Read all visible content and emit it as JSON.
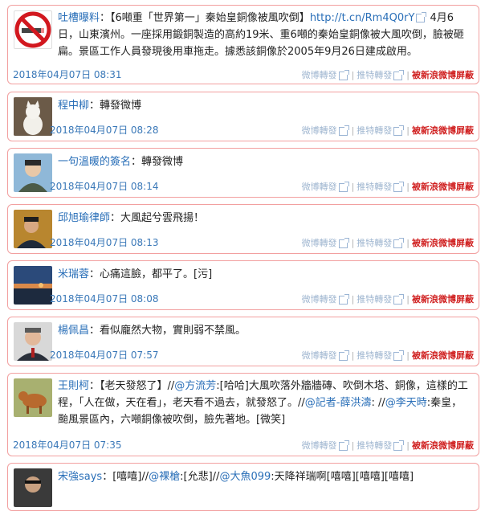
{
  "posts": [
    {
      "user": "吐槽曝料",
      "colon": "：",
      "text_a": "【6噸重「世界第一」秦始皇銅像被風吹倒】",
      "link": "http://t.cn/Rm4Q0rY",
      "text_b": " 4月6日，山東濱州。一座採用鍛銅製造的高約19米、重6噸的秦始皇銅像被大風吹倒，臉被砸扁。景區工作人員發現後用車拖走。據悉該銅像於2005年9月26日建成啟用。",
      "time": "2018年04月07日 08:31",
      "avatar_icon": "no-smoking-icon"
    },
    {
      "user": "程中柳",
      "text": "：轉發微博",
      "time": "2018年04月07日 08:28",
      "avatar_icon": "cat-photo-icon"
    },
    {
      "user": "一句溫暖的簽名",
      "text": "：轉發微博",
      "time": "2018年04月07日 08:14",
      "avatar_icon": "portrait-photo-icon"
    },
    {
      "user": "邱旭瑜律師",
      "text": "：大風起兮雲飛揚！",
      "time": "2018年04月07日 08:13",
      "avatar_icon": "portrait-photo-icon"
    },
    {
      "user": "米瑞蓉",
      "text": "：心痛這臉，都平了。[污]",
      "time": "2018年04月07日 08:08",
      "avatar_icon": "sunset-photo-icon"
    },
    {
      "user": "楊佩昌",
      "text": "：看似龐然大物，實則弱不禁風。",
      "time": "2018年04月07日 07:57",
      "avatar_icon": "portrait-photo-icon"
    },
    {
      "user": "王則柯",
      "text_a": "：【老天發怒了】//",
      "m1": "@方流芳",
      "text_b": ":[哈哈]大風吹落外牆牆磚、吹倒木塔、銅像，這樣的工程，「人在做，天在看」，老天看不過去，就發怒了。//",
      "m2": "@記者-薛洪濤",
      "text_c": ": //",
      "m3": "@李天時",
      "text_d": ":秦皇，颱風景區內，六噸銅像被吹倒，臉先著地。[微笑]",
      "time": "2018年04月07日 07:35",
      "avatar_icon": "dog-photo-icon"
    },
    {
      "user": "宋強says",
      "text_a": "：[嘻嘻]//",
      "m1": "@裸槍",
      "text_b": ":[允悲]//",
      "m2": "@大魚099",
      "text_c": ":天降祥瑞啊[嘻嘻][嘻嘻][嘻嘻]",
      "avatar_icon": "portrait-photo-icon"
    }
  ],
  "actions": {
    "weibo_repost": "微博轉發",
    "twitter_repost": "推特轉發",
    "separator": "|",
    "censored": "被新浪微博屏蔽"
  }
}
